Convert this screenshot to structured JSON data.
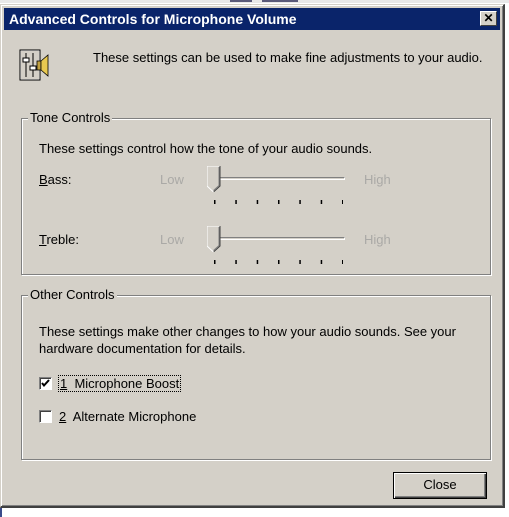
{
  "window": {
    "title": "Advanced Controls for Microphone Volume",
    "close_glyph": "✕"
  },
  "intro": {
    "icon": "speaker-settings-icon",
    "text": "These settings can be used to make fine adjustments to your audio."
  },
  "tone_controls": {
    "legend": "Tone Controls",
    "description": "These settings control how the tone of your audio sounds.",
    "bass": {
      "mnemonic": "B",
      "rest": "ass:",
      "low": "Low",
      "high": "High",
      "level": 0,
      "enabled": false
    },
    "treble": {
      "mnemonic": "T",
      "rest": "reble:",
      "low": "Low",
      "high": "High",
      "level": 0,
      "enabled": false
    }
  },
  "other_controls": {
    "legend": "Other Controls",
    "description": "These settings make other changes to how your audio sounds.  See your hardware documentation for details.",
    "options": [
      {
        "mnemonic": "1",
        "rest": "  Microphone Boost",
        "checked": true
      },
      {
        "mnemonic": "2",
        "rest": "  Alternate Microphone",
        "checked": false
      }
    ]
  },
  "buttons": {
    "close": "Close"
  }
}
